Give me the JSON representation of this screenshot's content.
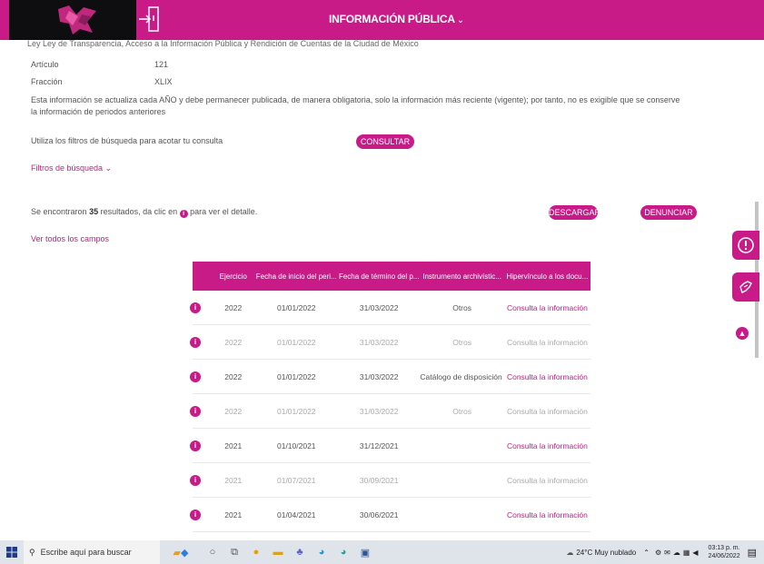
{
  "header": {
    "title": "INFORMACIÓN PÚBLICA",
    "chevron": "⌄"
  },
  "meta": {
    "ley_cut": "Ley   Ley de Transparencia, Acceso a la Información Pública y Rendición de Cuentas de la Ciudad de México",
    "articulo_label": "Artículo",
    "articulo_value": "121",
    "fraccion_label": "Fracción",
    "fraccion_value": "XLIX"
  },
  "notice": "Esta información se actualiza cada AÑO y debe permanecer publicada, de manera obligatoria, solo la información más reciente (vigente); por tanto, no es exigible que se conserve la información de periodos anteriores",
  "filters": {
    "hint": "Utiliza los filtros de búsqueda para acotar tu consulta",
    "consultar": "CONSULTAR",
    "toggle": "Filtros de búsqueda ⌄"
  },
  "results": {
    "prefix": "Se encontraron",
    "count": "35",
    "middle": "resultados, da clic en",
    "suffix": "para ver el detalle."
  },
  "actions": {
    "descargar": "DESCARGAR",
    "denunciar": "DENUNCIAR",
    "ver_todos": "Ver todos los campos"
  },
  "table": {
    "headers": [
      "Ejercicio",
      "Fecha de inicio del peri...",
      "Fecha de término del p...",
      "Instrumento archivístic...",
      "Hipervínculo a los docu..."
    ],
    "rows": [
      [
        "2022",
        "01/01/2022",
        "31/03/2022",
        "Otros",
        "Consulta la información"
      ],
      [
        "2022",
        "01/01/2022",
        "31/03/2022",
        "Otros",
        "Consulta la información"
      ],
      [
        "2022",
        "01/01/2022",
        "31/03/2022",
        "Catálogo de disposición doc...",
        "Consulta la información"
      ],
      [
        "2022",
        "01/01/2022",
        "31/03/2022",
        "Otros",
        "Consulta la información"
      ],
      [
        "2021",
        "01/10/2021",
        "31/12/2021",
        "",
        "Consulta la información"
      ],
      [
        "2021",
        "01/07/2021",
        "30/09/2021",
        "",
        "Consulta la información"
      ],
      [
        "2021",
        "01/04/2021",
        "30/06/2021",
        "",
        "Consulta la información"
      ]
    ]
  },
  "taskbar": {
    "search_placeholder": "Escribe aquí para buscar",
    "weather": "24°C  Muy nublado",
    "time": "03:13 p. m.",
    "date": "24/06/2022"
  },
  "colors": {
    "brand": "#c81b88",
    "logo_bg": "#0e0e10"
  },
  "icons": {
    "info": "info-icon",
    "login": "login-icon",
    "side_alert": "alert-icon",
    "side_hand": "hand-icon",
    "scroll_up": "scroll-up-icon"
  }
}
